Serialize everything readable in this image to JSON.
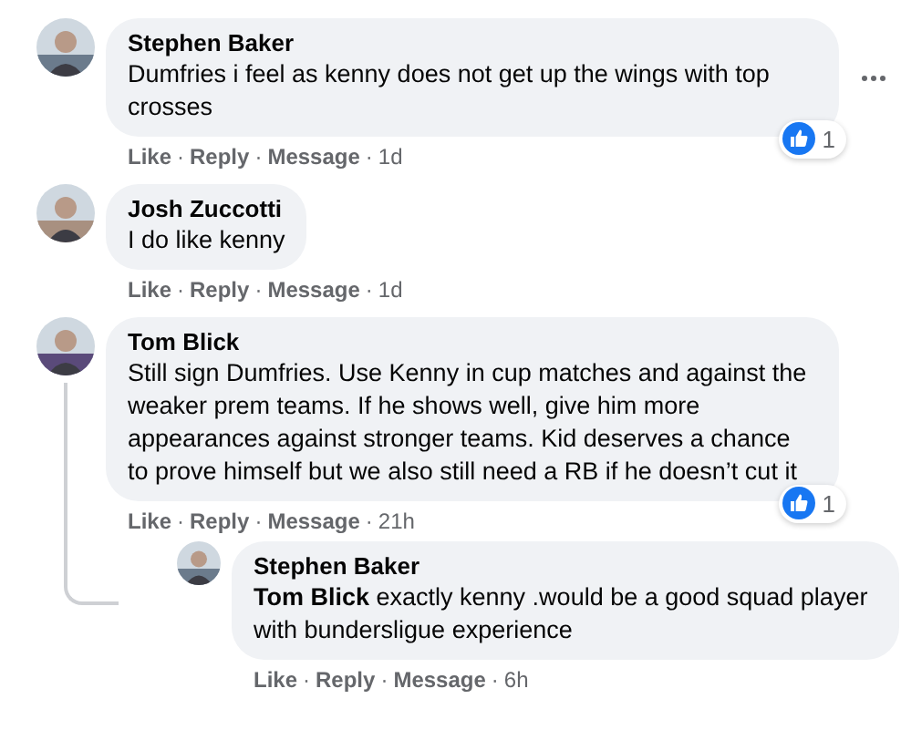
{
  "action_separator": "·",
  "comments": [
    {
      "author": "Stephen Baker",
      "text": "Dumfries i feel as kenny does not get up the wings with top crosses",
      "has_menu": true,
      "reaction_count": "1",
      "actions": [
        "Like",
        "Reply",
        "Message"
      ],
      "time": "1d"
    },
    {
      "author": "Josh Zuccotti",
      "text": "I do like kenny",
      "has_menu": false,
      "actions": [
        "Like",
        "Reply",
        "Message"
      ],
      "time": "1d"
    },
    {
      "author": "Tom Blick",
      "text": "Still sign Dumfries. Use Kenny in cup matches and against the weaker prem teams. If he shows well, give him more appearances against stronger teams. Kid deserves a chance to prove himself but we also still need a RB if he doesn’t cut it",
      "has_menu": false,
      "reaction_count": "1",
      "actions": [
        "Like",
        "Reply",
        "Message"
      ],
      "time": "21h",
      "replies": [
        {
          "author": "Stephen Baker",
          "text": "**Tom Blick** exactly kenny .would be a good squad player with bundersligue experience",
          "has_menu": false,
          "actions": [
            "Like",
            "Reply",
            "Message"
          ],
          "time": "6h"
        }
      ]
    }
  ]
}
